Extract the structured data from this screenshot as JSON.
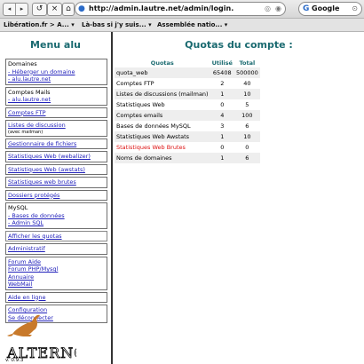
{
  "toolbar": {
    "back_icon": "back-arrow-icon",
    "forward_icon": "forward-arrow-icon",
    "reload_glyph": "↺",
    "stop_glyph": "×",
    "home_glyph": "⌂",
    "url": "http://admin.lautre.net/admin/login.",
    "search_engine": "Google"
  },
  "bookmarks": [
    "Libération.fr > A... ▾",
    "Là-bas si j'y suis... ▾",
    "Assemblée natio... ▾"
  ],
  "sidebar": {
    "title": "Menu alu",
    "sections": {
      "domaines": {
        "head": "Domaines",
        "link1": "- Héberger un domaine",
        "link2": "- alu.lautre.net"
      },
      "mails": {
        "head": "Comptes Mails",
        "link1": "- alu.lautre.net"
      },
      "ftp": "Comptes FTP",
      "discussion": {
        "link": "Listes de discussion",
        "small": "(avec mailman)"
      },
      "files": "Gestionnaire de fichiers",
      "webalizer": "Statistiques Web (webalizer)",
      "awstats": "Statistiques Web (awstats)",
      "brutes": "Statistiques web brutes",
      "dossiers": "Dossiers protégés",
      "mysql": {
        "head": "MySQL",
        "link1": "- Bases de données",
        "link2": "- Admin SQL"
      },
      "quotas": "Afficher les quotas",
      "admin": "Administratif",
      "forums": {
        "l1": "Forum Aide",
        "l2": "Forum PHP/Mysql",
        "l3": "Annuaire",
        "l4": "WebMail"
      },
      "aide": "Aide en ligne",
      "config": {
        "l1": "Configuration",
        "l2": "Se déconnecter"
      }
    },
    "logo_text": "ALTERNC",
    "version": "v. 0.9.3"
  },
  "main": {
    "title": "Quotas du compte :",
    "columns": [
      "Quotas",
      "Utilisé",
      "Total"
    ],
    "rows": [
      {
        "name": "quota_web",
        "used": "65408",
        "total": "500000",
        "over": false
      },
      {
        "name": "Comptes FTP",
        "used": "2",
        "total": "40",
        "over": false
      },
      {
        "name": "Listes de discussions (mailman)",
        "used": "1",
        "total": "10",
        "over": false
      },
      {
        "name": "Statistiques Web",
        "used": "0",
        "total": "5",
        "over": false
      },
      {
        "name": "Comptes emails",
        "used": "4",
        "total": "100",
        "over": false
      },
      {
        "name": "Bases de données MySQL",
        "used": "3",
        "total": "6",
        "over": false
      },
      {
        "name": "Statistiques Web Awstats",
        "used": "1",
        "total": "10",
        "over": false
      },
      {
        "name": "Statistiques Web Brutes",
        "used": "0",
        "total": "0",
        "over": true
      },
      {
        "name": "Noms de domaines",
        "used": "1",
        "total": "6",
        "over": false
      }
    ],
    "over_color": "#dd1111",
    "accent_color": "#1a6a70"
  }
}
